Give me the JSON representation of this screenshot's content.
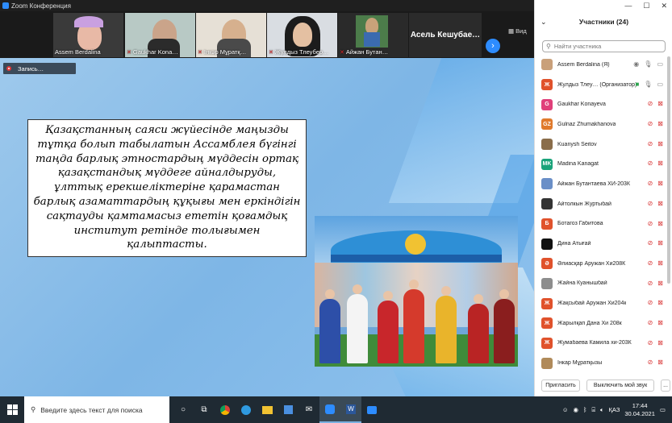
{
  "window": {
    "title": "Zoom Конференция"
  },
  "video_strip": {
    "tiles": [
      {
        "name": "Assem Berdalina",
        "muted": false
      },
      {
        "name": "Gaukhar Kona…",
        "muted": true
      },
      {
        "name": "Інкәр Мұратқ…",
        "muted": true
      },
      {
        "name": "Жулдыз Тлеубер…",
        "muted": true
      },
      {
        "name": "Айжан Бутан…",
        "muted": true
      }
    ],
    "name_only_tile": "Асель  Кешубае…",
    "view_label": "Вид"
  },
  "recording": {
    "label": "Запись…"
  },
  "slide": {
    "text": "Қазақстанның саяси жүйесінде маңызды тұтқа болып табылатын Ассамблея бүгінгі таңда барлық этностардың мүддесін ортақ қазақстандық мүддеге айналдыруды, ұлттық ерекшеліктеріне қарамастан барлық азаматтардың құқығы мен еркіндігін сақтауды қамтамасыз ететін қоғамдық институт ретінде толығымен қалыптасты."
  },
  "participants": {
    "title": "Участники (24)",
    "search_placeholder": "Найти участника",
    "list": [
      {
        "initials": "",
        "color": "#c9a07a",
        "name": "Assem Berdalina (Я)",
        "icons": "self"
      },
      {
        "initials": "Ж",
        "color": "#e0522c",
        "name": "Жулдыз Тлеу…  (Организатор)",
        "icons": "host"
      },
      {
        "initials": "G",
        "color": "#e0407a",
        "name": "Gaukhar Konayeva",
        "icons": "off"
      },
      {
        "initials": "GZ",
        "color": "#e07a2c",
        "name": "Gulnaz Zhumakhanova",
        "icons": "off"
      },
      {
        "initials": "",
        "color": "#8a6d4a",
        "name": "Kuanysh Seitov",
        "icons": "off"
      },
      {
        "initials": "MK",
        "color": "#1aa37a",
        "name": "Madina Kanagat",
        "icons": "off"
      },
      {
        "initials": "",
        "color": "#6a8fc7",
        "name": "Айжан Бутантаева ХИ-203К",
        "icons": "off"
      },
      {
        "initials": "",
        "color": "#333333",
        "name": "Айтолкын Журтыбай",
        "icons": "off"
      },
      {
        "initials": "Б",
        "color": "#e0522c",
        "name": "Ботагоз Габитова",
        "icons": "off"
      },
      {
        "initials": "",
        "color": "#111111",
        "name": "Дина Атығай",
        "icons": "off"
      },
      {
        "initials": "Ә",
        "color": "#e0522c",
        "name": "Әлиасқар Аружан Хи208К",
        "icons": "off"
      },
      {
        "initials": "",
        "color": "#8d8d8d",
        "name": "Жайна Куанышбай",
        "icons": "off"
      },
      {
        "initials": "Ж",
        "color": "#e0522c",
        "name": "Жақсыбай Аружан Хи204к",
        "icons": "off"
      },
      {
        "initials": "Ж",
        "color": "#e0522c",
        "name": "Жарылқап Дана Хи 208к",
        "icons": "off"
      },
      {
        "initials": "Ж",
        "color": "#e0522c",
        "name": "Жумабаева Камила хи-203К",
        "icons": "off"
      },
      {
        "initials": "",
        "color": "#b08a5a",
        "name": "Інкар Мұратқызы",
        "icons": "off"
      }
    ],
    "invite_button": "Пригласить",
    "mute_button": "Выключить мой звук",
    "more_button": "..."
  },
  "taskbar": {
    "search_placeholder": "Введите здесь текст для поиска",
    "language": "ҚАЗ",
    "time": "17:44",
    "date": "30.04.2021"
  }
}
